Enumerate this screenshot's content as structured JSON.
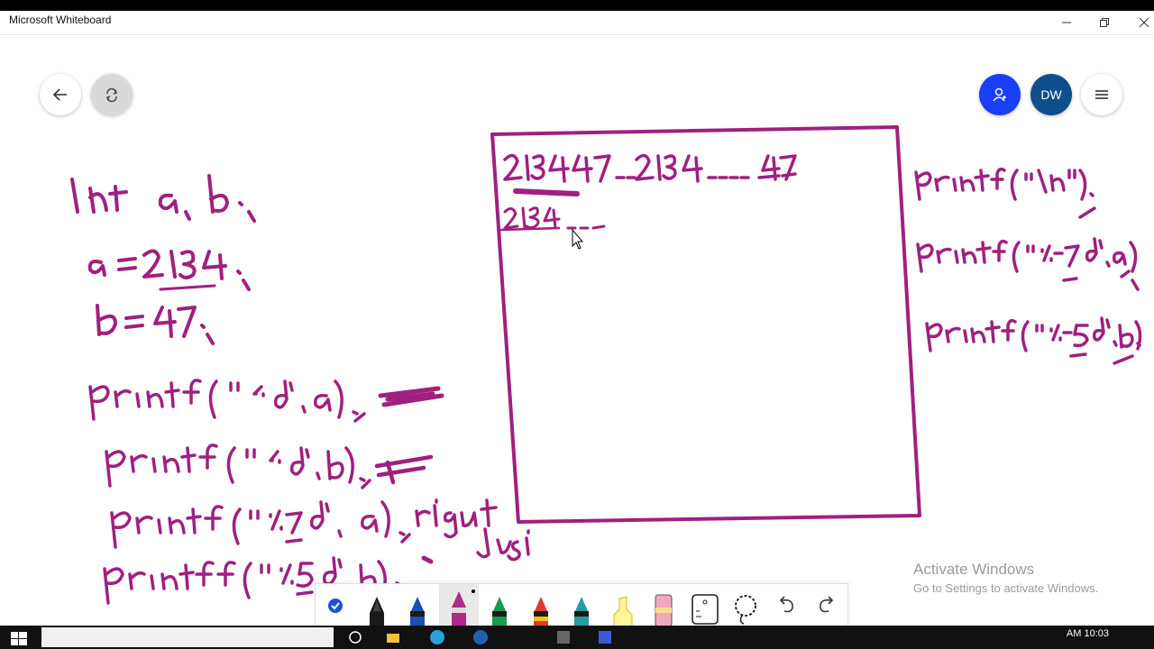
{
  "app": {
    "title": "Microsoft Whiteboard"
  },
  "header": {
    "avatar_initials": "DW"
  },
  "watermark": {
    "line1": "Activate Windows",
    "line2": "Go to Settings to activate Windows."
  },
  "taskbar": {
    "clock": "AM 10:03"
  },
  "ink_color": "#a0207f",
  "board": {
    "left_code": [
      "int a,b;",
      "a=2134;",
      "b=47;",
      "printf(\"%d\",a);",
      "printf(\"%d\",b);",
      "printf(\"%7d\",a); right justi",
      "printf(\"%5d\",b);"
    ],
    "box_output": [
      "213447___2134____47",
      "2134___"
    ],
    "right_code": [
      "printf(\"\\n\");",
      "printf(\"%-7d\",a);",
      "printf(\"%-5d\",b);"
    ]
  },
  "toolbar": {
    "tools": [
      "select-check",
      "pen-black",
      "pen-blue",
      "pen-magenta",
      "pen-green",
      "pen-red",
      "pen-teal",
      "highlighter-yellow",
      "eraser",
      "ruler",
      "lasso",
      "undo",
      "redo"
    ]
  }
}
